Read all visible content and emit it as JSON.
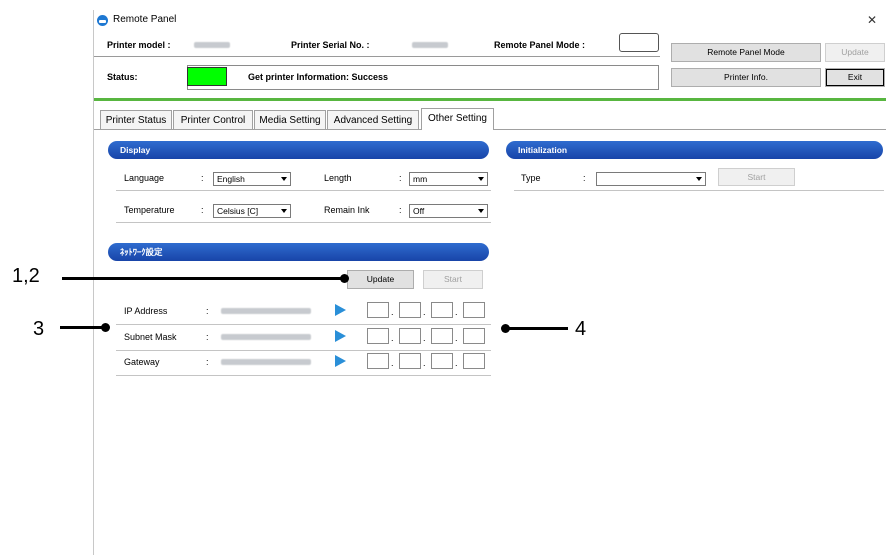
{
  "window": {
    "title": "Remote Panel"
  },
  "header": {
    "printer_model_label": "Printer model :",
    "serial_label": "Printer Serial No. :",
    "mode_label": "Remote Panel Mode :",
    "status_label": "Status:",
    "status_message": "Get printer Information: Success",
    "status_color": "#00ff00",
    "buttons": {
      "remote_panel_mode": "Remote Panel Mode",
      "update": "Update",
      "printer_info": "Printer Info.",
      "exit": "Exit"
    }
  },
  "tabs": [
    "Printer Status",
    "Printer Control",
    "Media Setting",
    "Advanced Setting",
    "Other Setting"
  ],
  "active_tab": "Other Setting",
  "display": {
    "header": "Display",
    "language_label": "Language",
    "language_value": "English",
    "length_label": "Length",
    "length_value": "mm",
    "temperature_label": "Temperature",
    "temperature_value": "Celsius [C]",
    "remain_ink_label": "Remain Ink",
    "remain_ink_value": "Off",
    "colon": ":"
  },
  "initialization": {
    "header": "Initialization",
    "type_label": "Type",
    "type_value": "",
    "start_button": "Start"
  },
  "network": {
    "header": "ﾈｯﾄﾜｰｸ設定",
    "update_button": "Update",
    "start_button": "Start",
    "rows": [
      {
        "label": "IP Address"
      },
      {
        "label": "Subnet Mask"
      },
      {
        "label": "Gateway"
      }
    ]
  },
  "annotations": {
    "callout_1": "1,2",
    "callout_2": "3",
    "callout_3": "4"
  },
  "colors": {
    "accent_blue": "#1e52b8",
    "green_bar": "#58b640"
  }
}
